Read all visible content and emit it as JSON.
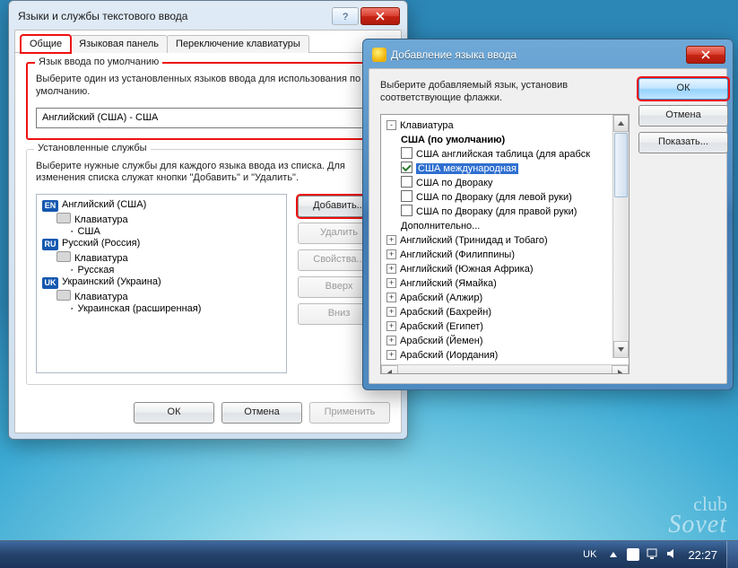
{
  "win1": {
    "title": "Языки и службы текстового ввода",
    "tabs": {
      "general": "Общие",
      "langbar": "Языковая панель",
      "switch": "Переключение клавиатуры"
    },
    "defaultGroup": {
      "legend": "Язык ввода по умолчанию",
      "desc": "Выберите один из установленных языков ввода для использования по умолчанию.",
      "comboValue": "Английский (США) - США"
    },
    "installedGroup": {
      "legend": "Установленные службы",
      "desc": "Выберите нужные службы для каждого языка ввода из списка. Для изменения списка служат кнопки \"Добавить\" и \"Удалить\".",
      "langs": [
        {
          "badge": "EN",
          "badgeClass": "badge-en",
          "name": "Английский (США)",
          "kbLabel": "Клавиатура",
          "layouts": [
            "США"
          ]
        },
        {
          "badge": "RU",
          "badgeClass": "badge-ru",
          "name": "Русский (Россия)",
          "kbLabel": "Клавиатура",
          "layouts": [
            "Русская"
          ]
        },
        {
          "badge": "UK",
          "badgeClass": "badge-uk",
          "name": "Украинский (Украина)",
          "kbLabel": "Клавиатура",
          "layouts": [
            "Украинская (расширенная)"
          ]
        }
      ],
      "buttons": {
        "add": "Добавить...",
        "remove": "Удалить",
        "props": "Свойства...",
        "up": "Вверх",
        "down": "Вниз"
      }
    },
    "bottom": {
      "ok": "ОК",
      "cancel": "Отмена",
      "apply": "Применить"
    }
  },
  "win2": {
    "title": "Добавление языка ввода",
    "desc": "Выберите добавляемый язык, установив соответствующие флажки.",
    "buttons": {
      "ok": "ОК",
      "cancel": "Отмена",
      "preview": "Показать..."
    },
    "tree": {
      "rootMinus": "Клавиатура",
      "usaDefault": "США (по умолчанию)",
      "checkItems": [
        {
          "label": "США английская таблица (для арабск",
          "checked": false,
          "selected": false
        },
        {
          "label": "США международная",
          "checked": true,
          "selected": true
        },
        {
          "label": "США по Двораку",
          "checked": false,
          "selected": false
        },
        {
          "label": "США по Двораку (для левой руки)",
          "checked": false,
          "selected": false
        },
        {
          "label": "США по Двораку (для правой руки)",
          "checked": false,
          "selected": false
        }
      ],
      "more": "Дополнительно...",
      "plusItems": [
        "Английский (Тринидад и Тобаго)",
        "Английский (Филиппины)",
        "Английский (Южная Африка)",
        "Английский (Ямайка)",
        "Арабский (Алжир)",
        "Арабский (Бахрейн)",
        "Арабский (Египет)",
        "Арабский (Йемен)",
        "Арабский (Иордания)"
      ]
    }
  },
  "taskbar": {
    "lang": "UK",
    "clock": "22:27"
  },
  "watermark": {
    "top": "club",
    "bot": "Sovet"
  }
}
